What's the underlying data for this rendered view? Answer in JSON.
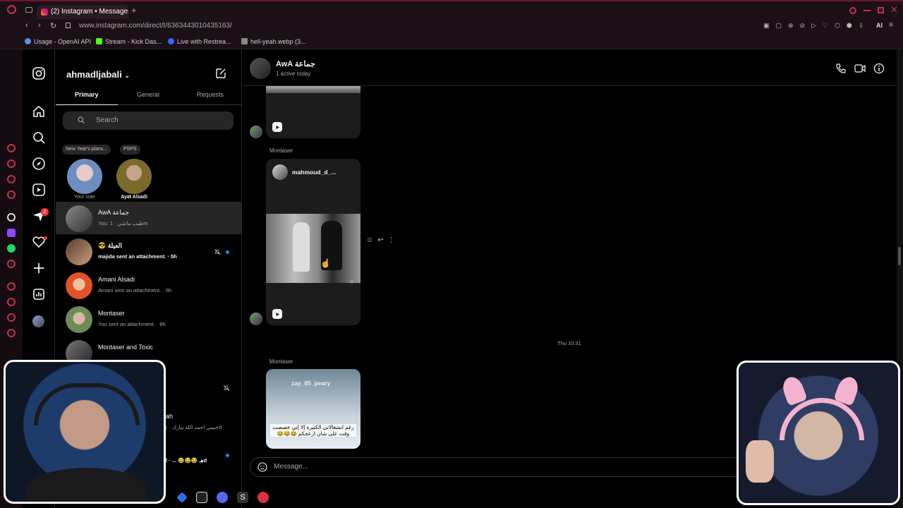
{
  "browser": {
    "tab_title": "(2) Instagram • Messages",
    "url": "www.instagram.com/direct/t/6363443010435163/",
    "bookmarks": [
      "Usage - OpenAI API",
      "Stream - Kick Das...",
      "Live with Restrea...",
      "hell-yeah.webp (3..."
    ],
    "ai_label": "AI"
  },
  "inbox": {
    "username": "ahmadljabali",
    "tabs": [
      "Primary",
      "General",
      "Requests"
    ],
    "search_placeholder": "Search",
    "notes": [
      {
        "bubble": "New Year's plans...",
        "label": "Your note"
      },
      {
        "bubble": "PSPS",
        "label": "Ayat Alsadi"
      }
    ],
    "threads": [
      {
        "name": "AwA جماعة",
        "sub": "You: طيب ماشي · 1m",
        "selected": true,
        "unread": false,
        "muted": false
      },
      {
        "name": "😎 العيلة",
        "sub": "majida sent an attachment. · 5h",
        "selected": false,
        "unread": true,
        "muted": true
      },
      {
        "name": "Amani Alsadi",
        "sub": "Amani sent an attachment. · 6h",
        "selected": false,
        "unread": false,
        "muted": false
      },
      {
        "name": "Montaser",
        "sub": "You sent an attachment. · 8h",
        "selected": false,
        "unread": false,
        "muted": false
      },
      {
        "name": "Montaser and Toxic",
        "sub": "",
        "selected": false,
        "unread": false,
        "muted": false
      }
    ],
    "hidden_rows": [
      {
        "name": "ah",
        "sub": "حبيبي احمد الله يبارك · 1d"
      },
      {
        "name": "",
        "sub": "هـ 😂😂😂 ... · 2d"
      }
    ]
  },
  "chat": {
    "title": "AwA جماعة",
    "status": "1 active today",
    "messages": [
      {
        "sender": "Montaser",
        "author": "mahmoud_d_...",
        "type": "reel"
      },
      {
        "sender": "Montaser",
        "author": "zay_85_peary",
        "caption": "رغم انشغالاتي الكثيرة إلا إني خصصت وقت على شان ازعجكم 😂😂😂",
        "type": "reel"
      }
    ],
    "timestamp": "Thu 10:31",
    "composer_placeholder": "Message..."
  },
  "colors": {
    "accent": "#0095f6",
    "background": "#000000",
    "selected_row": "#262626",
    "opera_red": "#c4304e"
  },
  "badges": {
    "notifications": "2"
  }
}
